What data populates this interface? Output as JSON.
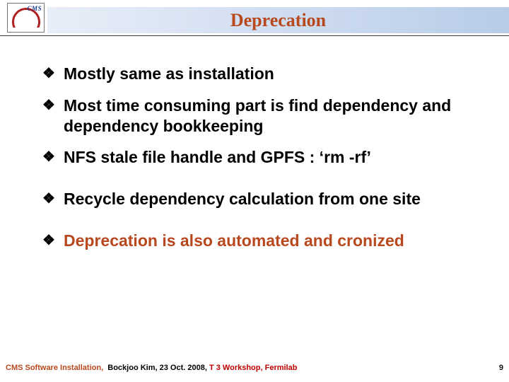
{
  "logo_text": "CMS",
  "title": "Deprecation",
  "bullets": [
    {
      "text": "Mostly same as installation",
      "highlight": false
    },
    {
      "text": "Most time consuming part is find dependency and dependency bookkeeping",
      "highlight": false
    },
    {
      "text": "NFS stale file handle and GPFS : ‘rm -rf’",
      "highlight": false
    },
    {
      "text": "Recycle dependency calculation from one site",
      "highlight": false
    },
    {
      "text": "Deprecation is also automated and cronized",
      "highlight": true
    }
  ],
  "footer": {
    "part1": "CMS Software Installation,",
    "part2": "Bockjoo Kim,",
    "part3": "23 Oct. 2008,",
    "part4": "T 3 Workshop, Fermilab"
  },
  "page_number": "9"
}
